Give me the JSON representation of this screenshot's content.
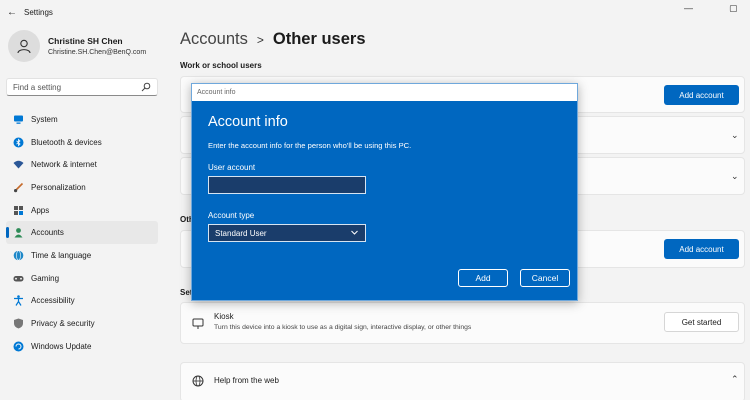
{
  "window": {
    "title": "Settings",
    "back_glyph": "←",
    "minimize_glyph": "—",
    "maximize_glyph": "▢"
  },
  "profile": {
    "name": "Christine SH Chen",
    "email": "Christine.SH.Chen@BenQ.com"
  },
  "search": {
    "placeholder": "Find a setting"
  },
  "nav": {
    "items": [
      {
        "label": "System",
        "icon": "monitor-icon",
        "color": "#0067c0"
      },
      {
        "label": "Bluetooth & devices",
        "icon": "bluetooth-icon",
        "color": "#0067c0"
      },
      {
        "label": "Network & internet",
        "icon": "wifi-icon",
        "color": "#2b5797"
      },
      {
        "label": "Personalization",
        "icon": "brush-icon",
        "color": "#c56a2a"
      },
      {
        "label": "Apps",
        "icon": "apps-icon",
        "color": "#555555"
      },
      {
        "label": "Accounts",
        "icon": "person-icon",
        "color": "#2e8b57"
      },
      {
        "label": "Time & language",
        "icon": "globe-icon",
        "color": "#1e88c8"
      },
      {
        "label": "Gaming",
        "icon": "gamepad-icon",
        "color": "#555555"
      },
      {
        "label": "Accessibility",
        "icon": "accessibility-icon",
        "color": "#0067c0"
      },
      {
        "label": "Privacy & security",
        "icon": "shield-icon",
        "color": "#666666"
      },
      {
        "label": "Windows Update",
        "icon": "update-icon",
        "color": "#0067c0"
      }
    ],
    "active_index": 5
  },
  "breadcrumb": {
    "parent": "Accounts",
    "separator": ">",
    "current": "Other users"
  },
  "sections": {
    "work_school": {
      "title": "Work or school users",
      "add_button": "Add account"
    },
    "other": {
      "title_visible": "Oth",
      "add_button": "Add account"
    },
    "setup": {
      "title_visible": "Set",
      "kiosk_title": "Kiosk",
      "kiosk_desc": "Turn this device into a kiosk to use as a digital sign, interactive display, or other things",
      "kiosk_button": "Get started"
    },
    "help": {
      "title": "Help from the web"
    }
  },
  "dialog": {
    "caption": "Account info",
    "heading": "Account info",
    "description": "Enter the account info for the person who'll be using this PC.",
    "user_label": "User account",
    "user_value": "",
    "type_label": "Account type",
    "type_value": "Standard User",
    "add_button": "Add",
    "cancel_button": "Cancel"
  },
  "colors": {
    "accent": "#0067c0",
    "dialog_bg": "#0067c0",
    "window_bg": "#f3f3f3"
  }
}
